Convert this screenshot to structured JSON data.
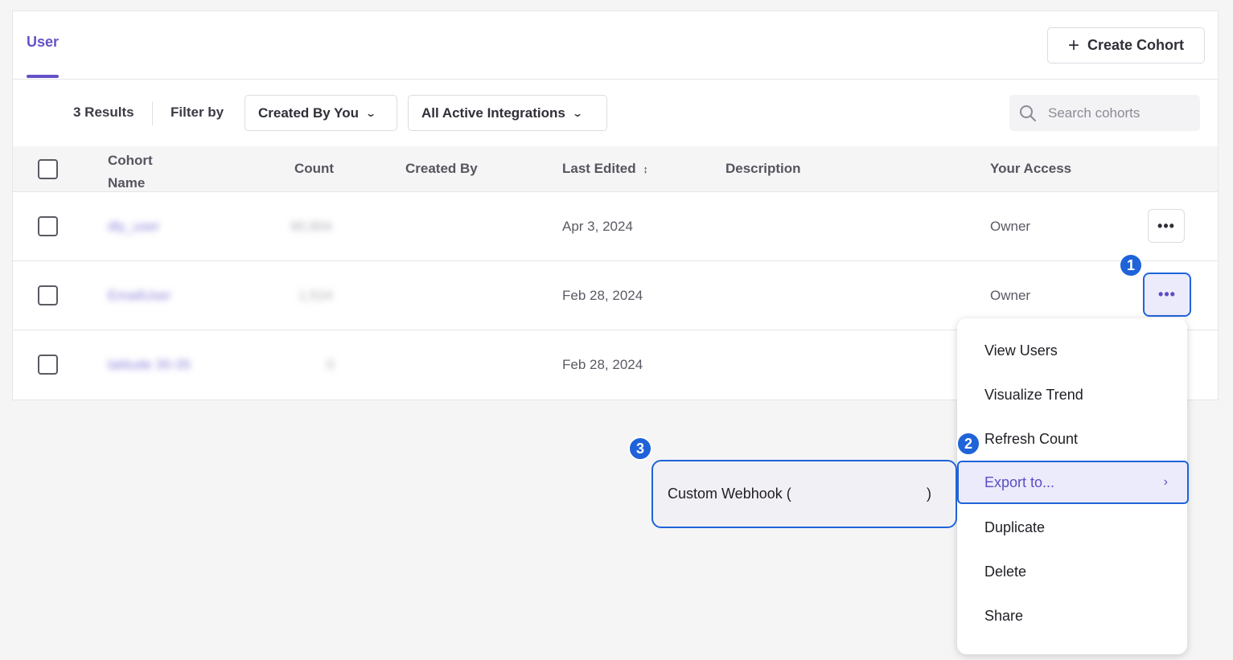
{
  "tabs": {
    "user": "User"
  },
  "header": {
    "create_label": "Create Cohort"
  },
  "filters": {
    "results": "3 Results",
    "filter_by": "Filter by",
    "created_by": "Created By You",
    "integrations": "All Active Integrations",
    "search_placeholder": "Search cohorts"
  },
  "table": {
    "headers": {
      "name": "Cohort\nName",
      "count": "Count",
      "created_by": "Created By",
      "last_edited": "Last Edited",
      "description": "Description",
      "access": "Your Access"
    },
    "rows": [
      {
        "name": "dly_user",
        "count": "90,904",
        "last_edited": "Apr 3, 2024",
        "access": "Owner"
      },
      {
        "name": "EmailUser",
        "count": "1,524",
        "last_edited": "Feb 28, 2024",
        "access": "Owner"
      },
      {
        "name": "latitude 30-35",
        "count": "0",
        "last_edited": "Feb 28, 2024",
        "access": ""
      }
    ]
  },
  "menu": {
    "items": [
      "View Users",
      "Visualize Trend",
      "Refresh Count",
      "Export to...",
      "Duplicate",
      "Delete",
      "Share"
    ]
  },
  "submenu": {
    "webhook": "Custom Webhook (",
    "close_paren": ")"
  },
  "badges": [
    "1",
    "2",
    "3"
  ],
  "colors": {
    "accent": "#6552c8",
    "highlight": "#1f63d9"
  }
}
